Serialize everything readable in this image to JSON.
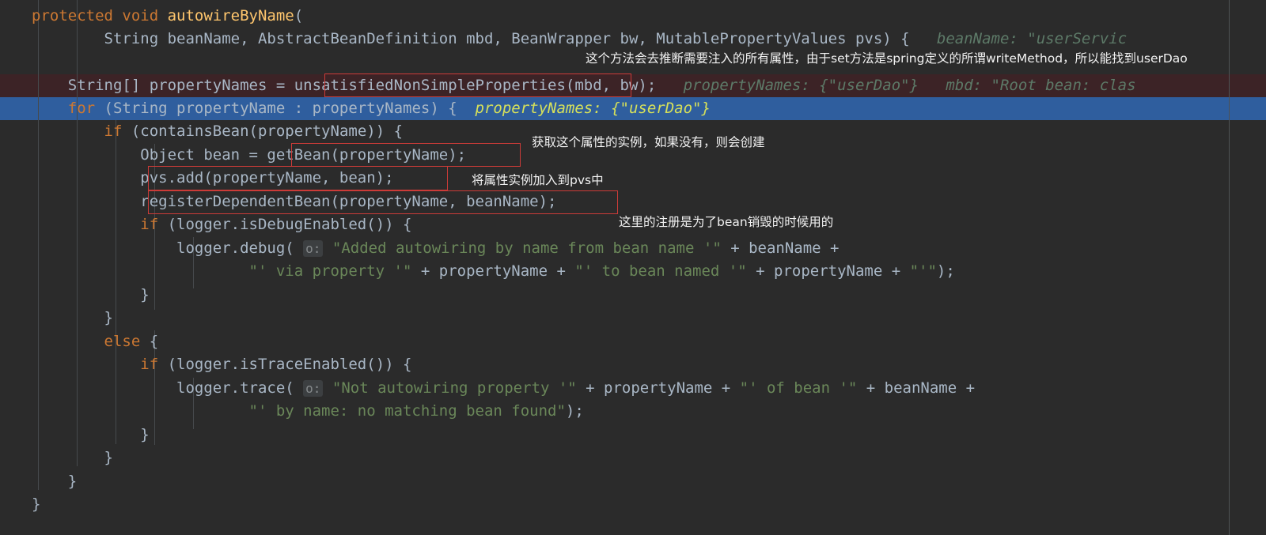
{
  "editor": {
    "title": "autowireByName",
    "background": "#2b2b2b",
    "exec_line_color": "#3c2326",
    "selected_line_color": "#2f5e9e",
    "indent_guide_color": "#464a4d",
    "margin_ruler_color": "#4e5254",
    "font_size_px": 19,
    "line_height_px": 29.5
  },
  "code": {
    "l1_a": "protected",
    "l1_b": " void ",
    "l1_c": "autowireByName",
    "l1_d": "(",
    "l2_a": "        String beanName, AbstractBeanDefinition mbd, BeanWrapper bw, MutablePropertyValues pvs) {",
    "l2_hint": "   beanName: \"userServic",
    "l3_a": "    String[] propertyNames = ",
    "l3_b": "unsatisfiedNonSimpleProperties",
    "l3_c": "(mbd, bw);",
    "l3_hint": "   propertyNames: {\"userDao\"}   mbd: \"Root bean: clas",
    "l4_kw": "    for ",
    "l4_a": "(String propertyName : propertyNames) {",
    "l4_hint": "  propertyNames: {\"userDao\"}",
    "l5_kw": "        if ",
    "l5_a": "(containsBean(propertyName)) {",
    "l6_a": "            Object bean = ",
    "l6_b": "getBean(propertyName);",
    "l7_a": "            pvs.add(propertyName, bean);",
    "l8_a": "            registerDependentBean(propertyName, beanName);",
    "l9_kw": "            if ",
    "l9_a": "(logger.isDebugEnabled()) {",
    "l10_a": "                logger.debug( ",
    "l10_badge": "o:",
    "l10_str": " \"Added autowiring by name from bean name '\"",
    "l10_b": " + beanName +",
    "l11_str_a": "                        \"' via property '\"",
    "l11_b": " + propertyName + ",
    "l11_str_b": "\"' to bean named '\"",
    "l11_c": " + propertyName + ",
    "l11_str_c": "\"'\"",
    "l11_d": ");",
    "l12_a": "            }",
    "l13_a": "        }",
    "l14_kw": "        else ",
    "l14_a": "{",
    "l15_kw": "            if ",
    "l15_a": "(logger.isTraceEnabled()) {",
    "l16_a": "                logger.trace( ",
    "l16_badge": "o:",
    "l16_str": " \"Not autowiring property '\"",
    "l16_b": " + propertyName + ",
    "l16_str_b": "\"' of bean '\"",
    "l16_c": " + beanName +",
    "l17_str": "                        \"' by name: no matching bean found\"",
    "l17_b": ");",
    "l18_a": "            }",
    "l19_a": "        }",
    "l20_a": "    }",
    "l21_a": "}"
  },
  "annotations": {
    "a1": "这个方法会去推断需要注入的所有属性，由于set方法是spring定义的所谓writeMethod，所以能找到userDao",
    "a2": "获取这个属性的实例，如果没有，则会创建",
    "a3": "将属性实例加入到pvs中",
    "a4": "这里的注册是为了bean销毁的时候用的"
  },
  "highlight_boxes": {
    "box1_label": "unsatisfiedNonSimpleProperties",
    "box2_label": "getBean(propertyName);",
    "box3_label": "pvs.add(propertyName, bean);",
    "box4_label": "registerDependentBean(propertyName, beanName);"
  }
}
